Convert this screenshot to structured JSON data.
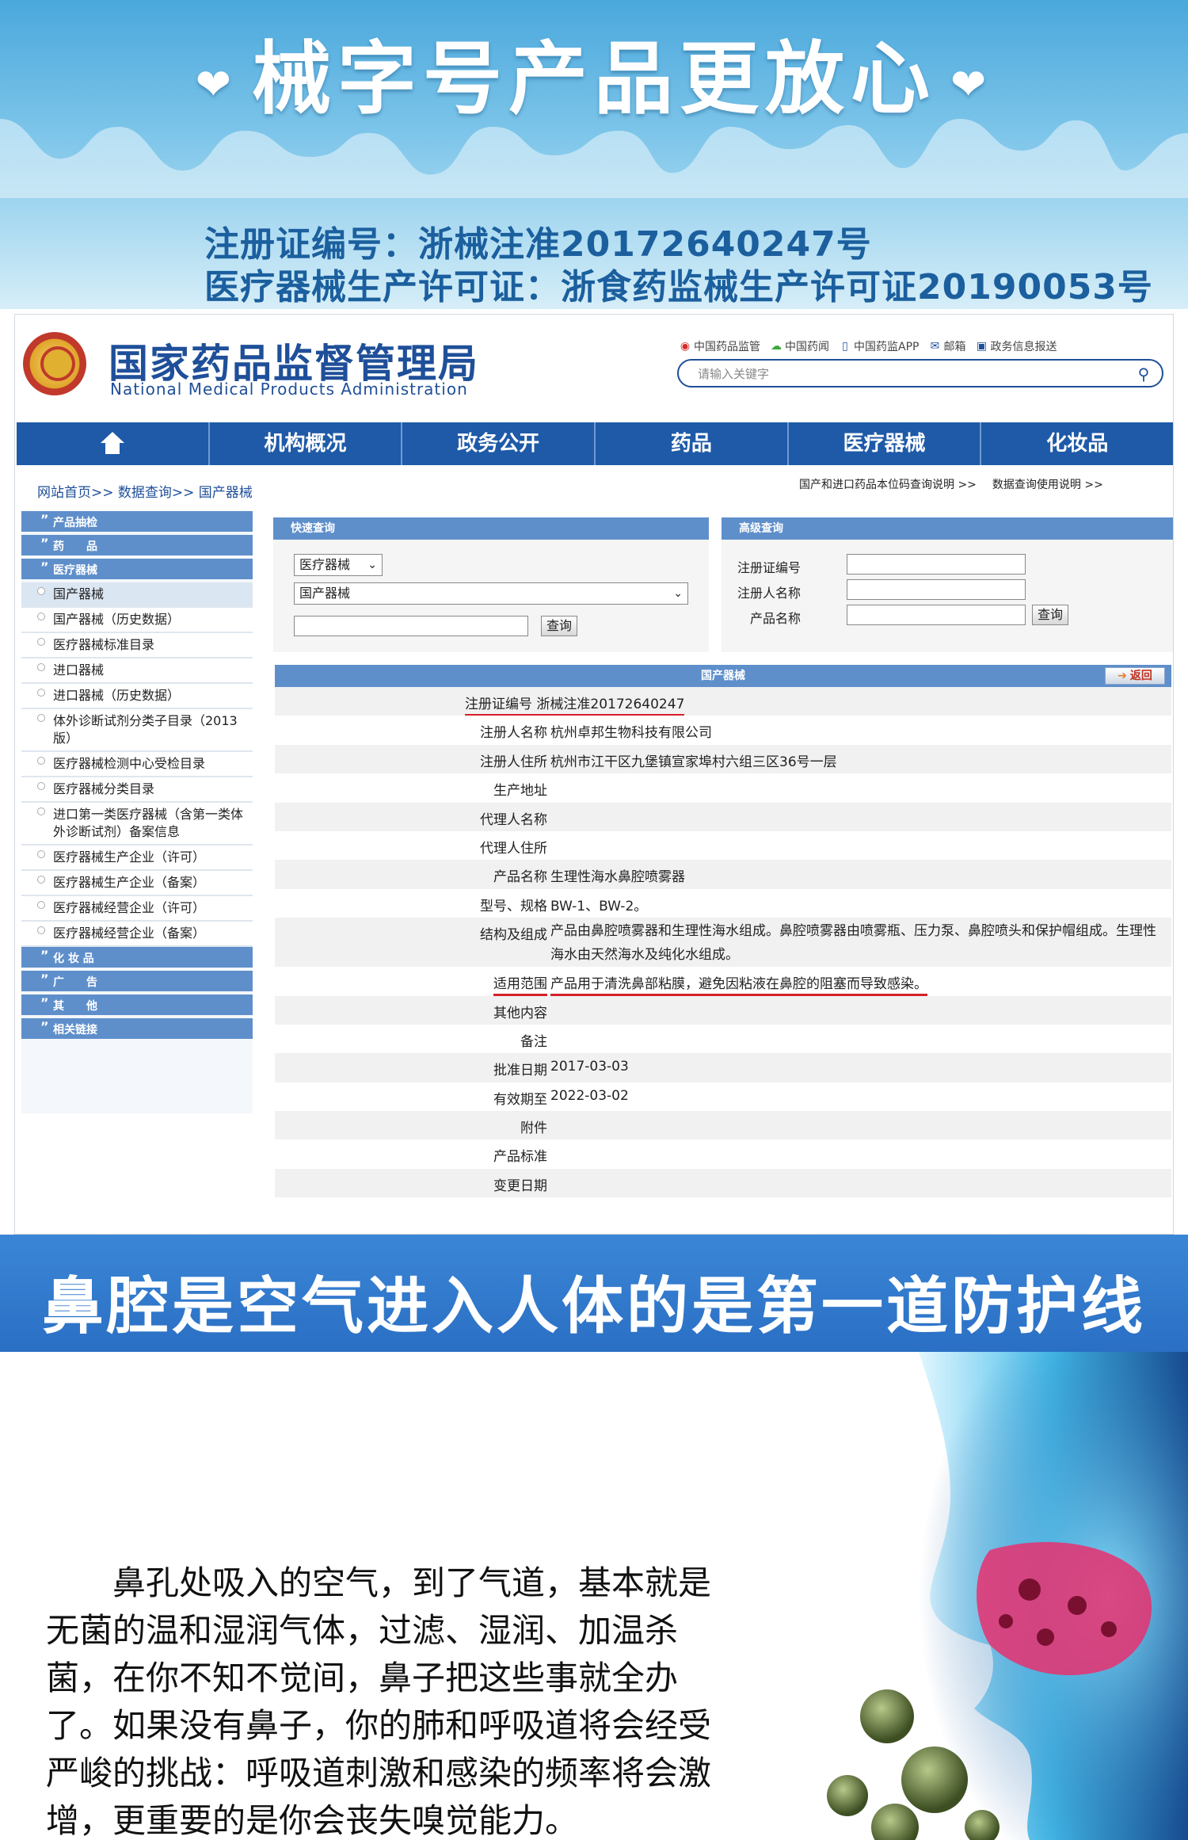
{
  "banner": {
    "title": "械字号产品更放心",
    "heart": "❤",
    "reg_number": "注册证编号：浙械注准20172640247号",
    "license": "医疗器械生产许可证：浙食药监械生产许可证20190053号"
  },
  "site": {
    "name_cn": "国家药品监督管理局",
    "name_en": "National Medical Products Administration",
    "quick_links": [
      "中国药品监管",
      "中国药闻",
      "中国药监APP",
      "邮箱",
      "政务信息报送"
    ],
    "search_placeholder": "请输入关键字",
    "nav": [
      "机构概况",
      "政务公开",
      "药品",
      "医疗器械",
      "化妆品"
    ],
    "breadcrumb": "网站首页>> 数据查询>> 国产器械",
    "sub_links": [
      "国产和进口药品本位码查询说明 >>",
      "数据查询使用说明 >>"
    ]
  },
  "sidebar": {
    "cat_products": "产品抽检",
    "cat_drugs": "药　　品",
    "cat_devices": "医疗器械",
    "items": [
      "国产器械",
      "国产器械（历史数据）",
      "医疗器械标准目录",
      "进口器械",
      "进口器械（历史数据）",
      "体外诊断试剂分类子目录（2013版）",
      "医疗器械检测中心受检目录",
      "医疗器械分类目录",
      "进口第一类医疗器械（含第一类体外诊断试剂）备案信息",
      "医疗器械生产企业（许可）",
      "医疗器械生产企业（备案）",
      "医疗器械经营企业（许可）",
      "医疗器械经营企业（备案）"
    ],
    "cat_cosmetics": "化 妆 品",
    "cat_ads": "广　　告",
    "cat_other": "其　　他",
    "cat_links": "相关链接"
  },
  "quick_query": {
    "title": "快速查询",
    "select1": "医疗器械",
    "select2": "国产器械",
    "button": "查询"
  },
  "adv_query": {
    "title": "高级查询",
    "label1": "注册证编号",
    "label2": "注册人名称",
    "label3": "产品名称",
    "button": "查询"
  },
  "results": {
    "title": "国产器械",
    "back": "返回",
    "rows": [
      {
        "label": "注册证编号",
        "value": "浙械注准20172640247"
      },
      {
        "label": "注册人名称",
        "value": "杭州卓邦生物科技有限公司"
      },
      {
        "label": "注册人住所",
        "value": "杭州市江干区九堡镇宣家埠村六组三区36号一层"
      },
      {
        "label": "生产地址",
        "value": ""
      },
      {
        "label": "代理人名称",
        "value": ""
      },
      {
        "label": "代理人住所",
        "value": ""
      },
      {
        "label": "产品名称",
        "value": "生理性海水鼻腔喷雾器"
      },
      {
        "label": "型号、规格",
        "value": "BW-1、BW-2。"
      },
      {
        "label": "结构及组成",
        "value": "产品由鼻腔喷雾器和生理性海水组成。鼻腔喷雾器由喷雾瓶、压力泵、鼻腔喷头和保护帽组成。生理性海水由天然海水及纯化水组成。"
      },
      {
        "label": "适用范围",
        "value": "产品用于清洗鼻部粘膜，避免因粘液在鼻腔的阻塞而导致感染。"
      },
      {
        "label": "其他内容",
        "value": ""
      },
      {
        "label": "备注",
        "value": ""
      },
      {
        "label": "批准日期",
        "value": "2017-03-03"
      },
      {
        "label": "有效期至",
        "value": "2022-03-02"
      },
      {
        "label": "附件",
        "value": ""
      },
      {
        "label": "产品标准",
        "value": ""
      },
      {
        "label": "变更日期",
        "value": ""
      }
    ]
  },
  "mid_banner": "鼻腔是空气进入人体的是第一道防护线",
  "body_text": "鼻孔处吸入的空气，到了气道，基本就是无菌的温和湿润气体，过滤、湿润、加温杀菌，在你不知不觉间，鼻子把这些事就全办了。如果没有鼻子，你的肺和呼吸道将会经受严峻的挑战：呼吸道刺激和感染的频率将会激增，更重要的是你会丧失嗅觉能力。",
  "colors": {
    "brand_blue": "#1e5aa8",
    "panel_blue": "#5e8fcb",
    "underline_red": "#d6202a"
  }
}
